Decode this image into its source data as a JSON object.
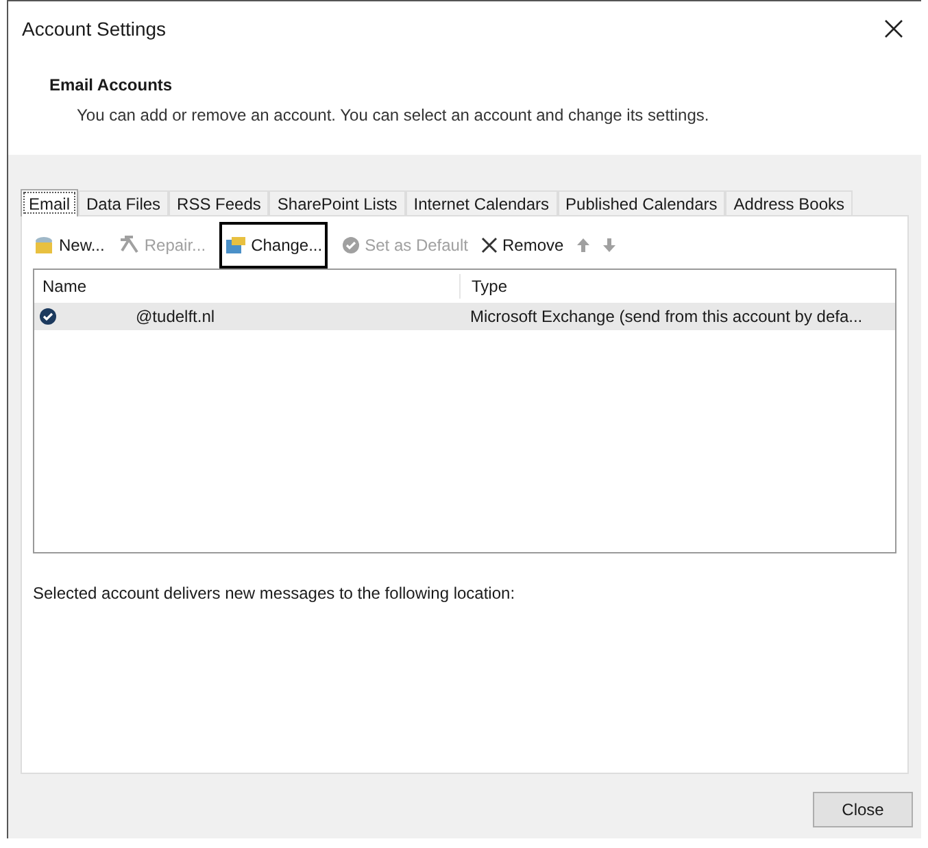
{
  "window": {
    "title": "Account Settings"
  },
  "header": {
    "title": "Email Accounts",
    "description": "You can add or remove an account. You can select an account and change its settings."
  },
  "tabs": [
    {
      "label": "Email",
      "selected": true
    },
    {
      "label": "Data Files",
      "selected": false
    },
    {
      "label": "RSS Feeds",
      "selected": false
    },
    {
      "label": "SharePoint Lists",
      "selected": false
    },
    {
      "label": "Internet Calendars",
      "selected": false
    },
    {
      "label": "Published Calendars",
      "selected": false
    },
    {
      "label": "Address Books",
      "selected": false
    }
  ],
  "toolbar": [
    {
      "kind": "new",
      "label": "New...",
      "disabled": false,
      "focused": false
    },
    {
      "kind": "repair",
      "label": "Repair...",
      "disabled": true,
      "focused": false
    },
    {
      "kind": "change",
      "label": "Change...",
      "disabled": false,
      "focused": true
    },
    {
      "kind": "default",
      "label": "Set as Default",
      "disabled": true,
      "focused": false
    },
    {
      "kind": "remove",
      "label": "Remove",
      "disabled": false,
      "focused": false
    },
    {
      "kind": "up",
      "disabled": true,
      "focused": false
    },
    {
      "kind": "down",
      "disabled": true,
      "focused": false
    }
  ],
  "table": {
    "columns": [
      "Name",
      "Type"
    ],
    "rows": [
      {
        "name": "@tudelft.nl",
        "type": "Microsoft Exchange (send from this account by defa...",
        "selected": true,
        "default": true
      }
    ]
  },
  "location_text": "Selected account delivers new messages to the following location:",
  "buttons": [
    {
      "label": "Close"
    }
  ]
}
